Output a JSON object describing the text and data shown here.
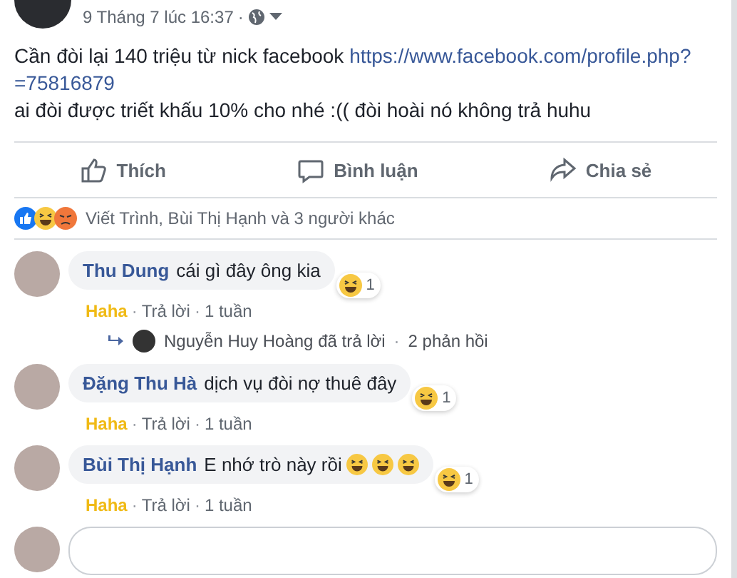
{
  "post": {
    "timestamp": "9 Tháng 7 lúc 16:37",
    "separator": "·",
    "text": [
      {
        "kind": "plain",
        "text": "Cần đòi lại 140 triệu từ nick facebook "
      },
      {
        "kind": "link",
        "text": "https://www.facebook.com/profile.php?"
      },
      {
        "kind": "break"
      },
      {
        "kind": "link",
        "text": "=75816879"
      },
      {
        "kind": "break"
      },
      {
        "kind": "plain",
        "text": "ai đòi được triết khấu 10% cho nhé :(( đòi hoài nó không trả huhu"
      }
    ]
  },
  "actions": [
    {
      "kind": "like",
      "label": "Thích"
    },
    {
      "kind": "comment",
      "label": "Bình luận"
    },
    {
      "kind": "share",
      "label": "Chia sẻ"
    }
  ],
  "reactions": {
    "icons": [
      {
        "kind": "like"
      },
      {
        "kind": "haha"
      },
      {
        "kind": "angry"
      }
    ],
    "summary": "Viết Trình, Bùi Thị Hạnh và 3 người khác"
  },
  "comments": [
    {
      "author": "Thu Dung",
      "text": "cái gì đây ông kia",
      "reaction_count": "1",
      "my_reaction": "Haha",
      "reacted": true,
      "separator_1": "·",
      "reply": "Trả lời",
      "separator_2": "·",
      "time": "1 tuần",
      "replies": {
        "text": "Nguyễn Huy Hoàng đã trả lời",
        "separator": "·",
        "count": "2 phản hồi"
      }
    },
    {
      "author": "Đặng Thu Hà",
      "text": "dịch vụ đòi nợ thuê đây",
      "reaction_count": "1",
      "my_reaction": "Haha",
      "reacted": true,
      "separator_1": "·",
      "reply": "Trả lời",
      "separator_2": "·",
      "time": "1 tuần"
    },
    {
      "author": "Bùi Thị Hạnh",
      "text": "E nhớ trò này rồi",
      "emojis": [
        {
          "kind": "haha"
        },
        {
          "kind": "haha"
        },
        {
          "kind": "haha"
        }
      ],
      "reaction_count": "1",
      "my_reaction": "Haha",
      "reacted": true,
      "separator_1": "·",
      "reply": "Trả lời",
      "separator_2": "·",
      "time": "1 tuần"
    }
  ]
}
